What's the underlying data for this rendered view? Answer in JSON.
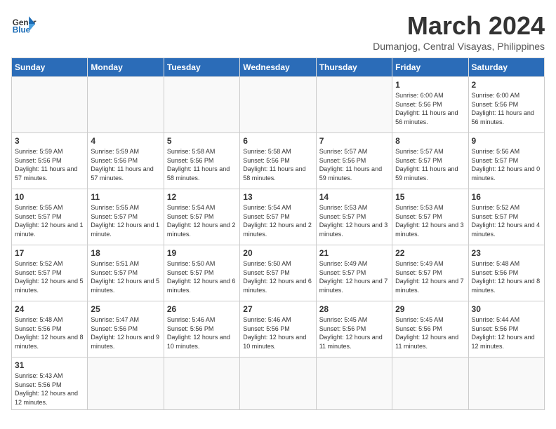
{
  "header": {
    "logo_general": "General",
    "logo_blue": "Blue",
    "title": "March 2024",
    "subtitle": "Dumanjog, Central Visayas, Philippines"
  },
  "days_of_week": [
    "Sunday",
    "Monday",
    "Tuesday",
    "Wednesday",
    "Thursday",
    "Friday",
    "Saturday"
  ],
  "weeks": [
    [
      {
        "day": "",
        "info": ""
      },
      {
        "day": "",
        "info": ""
      },
      {
        "day": "",
        "info": ""
      },
      {
        "day": "",
        "info": ""
      },
      {
        "day": "",
        "info": ""
      },
      {
        "day": "1",
        "info": "Sunrise: 6:00 AM\nSunset: 5:56 PM\nDaylight: 11 hours and 56 minutes."
      },
      {
        "day": "2",
        "info": "Sunrise: 6:00 AM\nSunset: 5:56 PM\nDaylight: 11 hours and 56 minutes."
      }
    ],
    [
      {
        "day": "3",
        "info": "Sunrise: 5:59 AM\nSunset: 5:56 PM\nDaylight: 11 hours and 57 minutes."
      },
      {
        "day": "4",
        "info": "Sunrise: 5:59 AM\nSunset: 5:56 PM\nDaylight: 11 hours and 57 minutes."
      },
      {
        "day": "5",
        "info": "Sunrise: 5:58 AM\nSunset: 5:56 PM\nDaylight: 11 hours and 58 minutes."
      },
      {
        "day": "6",
        "info": "Sunrise: 5:58 AM\nSunset: 5:56 PM\nDaylight: 11 hours and 58 minutes."
      },
      {
        "day": "7",
        "info": "Sunrise: 5:57 AM\nSunset: 5:56 PM\nDaylight: 11 hours and 59 minutes."
      },
      {
        "day": "8",
        "info": "Sunrise: 5:57 AM\nSunset: 5:57 PM\nDaylight: 11 hours and 59 minutes."
      },
      {
        "day": "9",
        "info": "Sunrise: 5:56 AM\nSunset: 5:57 PM\nDaylight: 12 hours and 0 minutes."
      }
    ],
    [
      {
        "day": "10",
        "info": "Sunrise: 5:55 AM\nSunset: 5:57 PM\nDaylight: 12 hours and 1 minute."
      },
      {
        "day": "11",
        "info": "Sunrise: 5:55 AM\nSunset: 5:57 PM\nDaylight: 12 hours and 1 minute."
      },
      {
        "day": "12",
        "info": "Sunrise: 5:54 AM\nSunset: 5:57 PM\nDaylight: 12 hours and 2 minutes."
      },
      {
        "day": "13",
        "info": "Sunrise: 5:54 AM\nSunset: 5:57 PM\nDaylight: 12 hours and 2 minutes."
      },
      {
        "day": "14",
        "info": "Sunrise: 5:53 AM\nSunset: 5:57 PM\nDaylight: 12 hours and 3 minutes."
      },
      {
        "day": "15",
        "info": "Sunrise: 5:53 AM\nSunset: 5:57 PM\nDaylight: 12 hours and 3 minutes."
      },
      {
        "day": "16",
        "info": "Sunrise: 5:52 AM\nSunset: 5:57 PM\nDaylight: 12 hours and 4 minutes."
      }
    ],
    [
      {
        "day": "17",
        "info": "Sunrise: 5:52 AM\nSunset: 5:57 PM\nDaylight: 12 hours and 5 minutes."
      },
      {
        "day": "18",
        "info": "Sunrise: 5:51 AM\nSunset: 5:57 PM\nDaylight: 12 hours and 5 minutes."
      },
      {
        "day": "19",
        "info": "Sunrise: 5:50 AM\nSunset: 5:57 PM\nDaylight: 12 hours and 6 minutes."
      },
      {
        "day": "20",
        "info": "Sunrise: 5:50 AM\nSunset: 5:57 PM\nDaylight: 12 hours and 6 minutes."
      },
      {
        "day": "21",
        "info": "Sunrise: 5:49 AM\nSunset: 5:57 PM\nDaylight: 12 hours and 7 minutes."
      },
      {
        "day": "22",
        "info": "Sunrise: 5:49 AM\nSunset: 5:57 PM\nDaylight: 12 hours and 7 minutes."
      },
      {
        "day": "23",
        "info": "Sunrise: 5:48 AM\nSunset: 5:56 PM\nDaylight: 12 hours and 8 minutes."
      }
    ],
    [
      {
        "day": "24",
        "info": "Sunrise: 5:48 AM\nSunset: 5:56 PM\nDaylight: 12 hours and 8 minutes."
      },
      {
        "day": "25",
        "info": "Sunrise: 5:47 AM\nSunset: 5:56 PM\nDaylight: 12 hours and 9 minutes."
      },
      {
        "day": "26",
        "info": "Sunrise: 5:46 AM\nSunset: 5:56 PM\nDaylight: 12 hours and 10 minutes."
      },
      {
        "day": "27",
        "info": "Sunrise: 5:46 AM\nSunset: 5:56 PM\nDaylight: 12 hours and 10 minutes."
      },
      {
        "day": "28",
        "info": "Sunrise: 5:45 AM\nSunset: 5:56 PM\nDaylight: 12 hours and 11 minutes."
      },
      {
        "day": "29",
        "info": "Sunrise: 5:45 AM\nSunset: 5:56 PM\nDaylight: 12 hours and 11 minutes."
      },
      {
        "day": "30",
        "info": "Sunrise: 5:44 AM\nSunset: 5:56 PM\nDaylight: 12 hours and 12 minutes."
      }
    ],
    [
      {
        "day": "31",
        "info": "Sunrise: 5:43 AM\nSunset: 5:56 PM\nDaylight: 12 hours and 12 minutes."
      },
      {
        "day": "",
        "info": ""
      },
      {
        "day": "",
        "info": ""
      },
      {
        "day": "",
        "info": ""
      },
      {
        "day": "",
        "info": ""
      },
      {
        "day": "",
        "info": ""
      },
      {
        "day": "",
        "info": ""
      }
    ]
  ]
}
